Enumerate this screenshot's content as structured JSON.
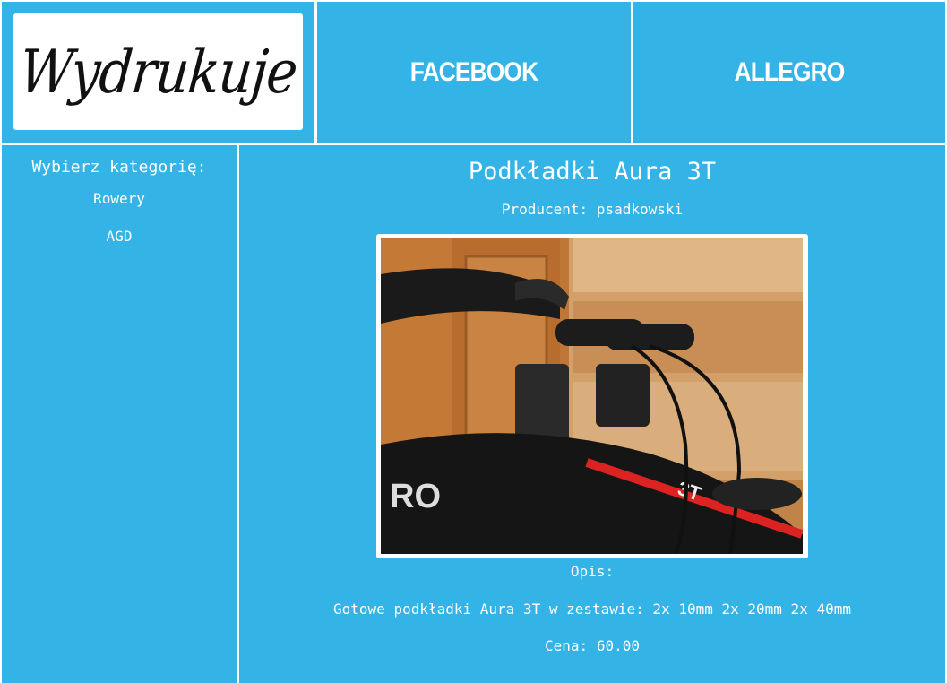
{
  "header": {
    "logo_text": "Wydrukuje",
    "nav": [
      {
        "label": "FACEBOOK"
      },
      {
        "label": "ALLEGRO"
      }
    ]
  },
  "sidebar": {
    "title": "Wybierz kategorię:",
    "items": [
      {
        "label": "Rowery"
      },
      {
        "label": "AGD"
      }
    ]
  },
  "product": {
    "title": "Podkładki Aura 3T",
    "producer": "Producent: psadkowski",
    "photo_icon": "bicycle-handlebar-photo",
    "description_label": "Opis:",
    "description": "Gotowe podkładki Aura 3T w zestawie: 2x 10mm 2x 20mm 2x 40mm",
    "price": "Cena: 60.00"
  },
  "colors": {
    "background": "#34b4e6",
    "text": "#ffffff",
    "separator": "#ffffff"
  }
}
